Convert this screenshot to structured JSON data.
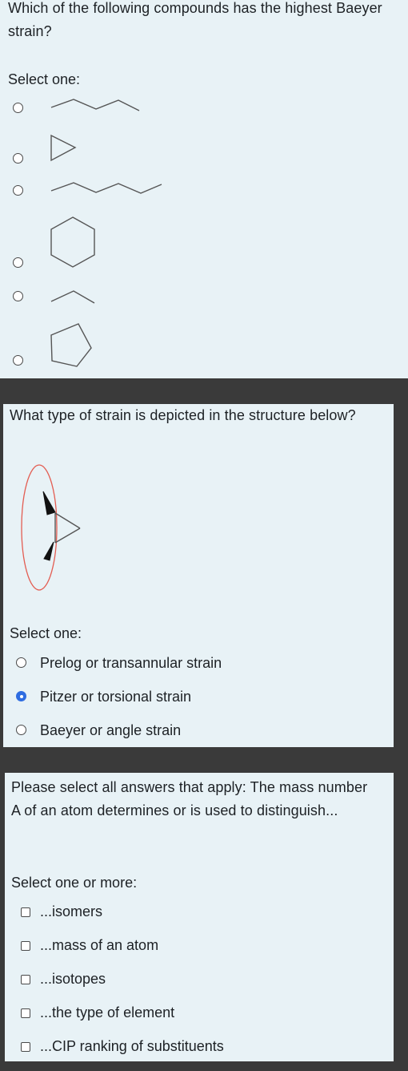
{
  "q1": {
    "question": "Which of the following compounds has the highest Baeyer strain?",
    "prompt": "Select one:",
    "options": [
      {
        "icon": "pentane-zigzag-structure"
      },
      {
        "icon": "cyclopropane-structure"
      },
      {
        "icon": "hexane-zigzag-structure"
      },
      {
        "icon": "cyclohexane-structure"
      },
      {
        "icon": "propane-structure"
      },
      {
        "icon": "cyclopentane-structure"
      }
    ]
  },
  "q2": {
    "question": "What type of strain is depicted in the structure below?",
    "prompt": "Select one:",
    "options": [
      {
        "label": "Prelog or transannular strain",
        "selected": false
      },
      {
        "label": "Pitzer or torsional strain",
        "selected": true
      },
      {
        "label": "Baeyer or angle strain",
        "selected": false
      }
    ],
    "highlight_color": "#e35d52",
    "selected_color": "#2f6de1"
  },
  "q3": {
    "question": "Please select all answers that apply: The mass number A of an atom determines or is used to distinguish...",
    "prompt": "Select one or more:",
    "options": [
      {
        "label": "...isomers"
      },
      {
        "label": "...mass of an atom"
      },
      {
        "label": "...isotopes"
      },
      {
        "label": "...the type of element"
      },
      {
        "label": "...CIP ranking of substituents"
      }
    ]
  }
}
